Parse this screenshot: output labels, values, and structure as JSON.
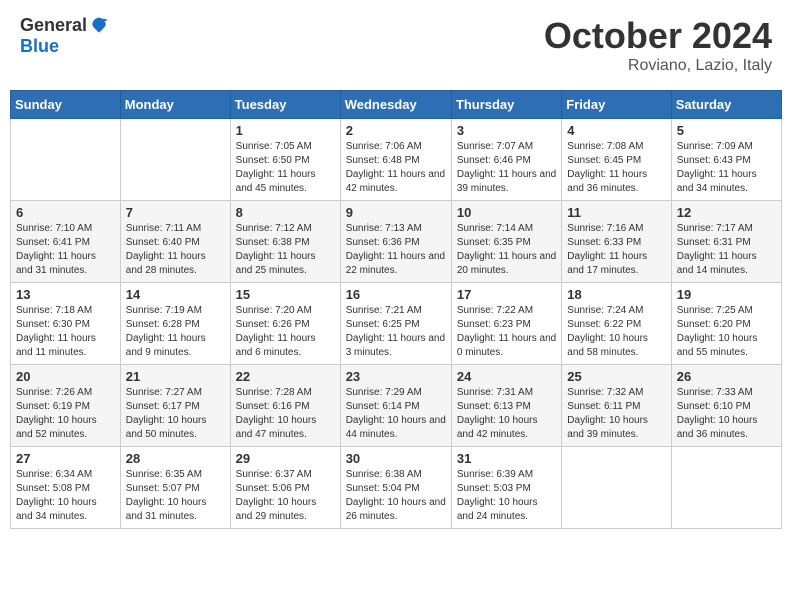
{
  "header": {
    "logo_general": "General",
    "logo_blue": "Blue",
    "month": "October 2024",
    "location": "Roviano, Lazio, Italy"
  },
  "weekdays": [
    "Sunday",
    "Monday",
    "Tuesday",
    "Wednesday",
    "Thursday",
    "Friday",
    "Saturday"
  ],
  "weeks": [
    [
      {
        "day": "",
        "info": ""
      },
      {
        "day": "",
        "info": ""
      },
      {
        "day": "1",
        "info": "Sunrise: 7:05 AM\nSunset: 6:50 PM\nDaylight: 11 hours and 45 minutes."
      },
      {
        "day": "2",
        "info": "Sunrise: 7:06 AM\nSunset: 6:48 PM\nDaylight: 11 hours and 42 minutes."
      },
      {
        "day": "3",
        "info": "Sunrise: 7:07 AM\nSunset: 6:46 PM\nDaylight: 11 hours and 39 minutes."
      },
      {
        "day": "4",
        "info": "Sunrise: 7:08 AM\nSunset: 6:45 PM\nDaylight: 11 hours and 36 minutes."
      },
      {
        "day": "5",
        "info": "Sunrise: 7:09 AM\nSunset: 6:43 PM\nDaylight: 11 hours and 34 minutes."
      }
    ],
    [
      {
        "day": "6",
        "info": "Sunrise: 7:10 AM\nSunset: 6:41 PM\nDaylight: 11 hours and 31 minutes."
      },
      {
        "day": "7",
        "info": "Sunrise: 7:11 AM\nSunset: 6:40 PM\nDaylight: 11 hours and 28 minutes."
      },
      {
        "day": "8",
        "info": "Sunrise: 7:12 AM\nSunset: 6:38 PM\nDaylight: 11 hours and 25 minutes."
      },
      {
        "day": "9",
        "info": "Sunrise: 7:13 AM\nSunset: 6:36 PM\nDaylight: 11 hours and 22 minutes."
      },
      {
        "day": "10",
        "info": "Sunrise: 7:14 AM\nSunset: 6:35 PM\nDaylight: 11 hours and 20 minutes."
      },
      {
        "day": "11",
        "info": "Sunrise: 7:16 AM\nSunset: 6:33 PM\nDaylight: 11 hours and 17 minutes."
      },
      {
        "day": "12",
        "info": "Sunrise: 7:17 AM\nSunset: 6:31 PM\nDaylight: 11 hours and 14 minutes."
      }
    ],
    [
      {
        "day": "13",
        "info": "Sunrise: 7:18 AM\nSunset: 6:30 PM\nDaylight: 11 hours and 11 minutes."
      },
      {
        "day": "14",
        "info": "Sunrise: 7:19 AM\nSunset: 6:28 PM\nDaylight: 11 hours and 9 minutes."
      },
      {
        "day": "15",
        "info": "Sunrise: 7:20 AM\nSunset: 6:26 PM\nDaylight: 11 hours and 6 minutes."
      },
      {
        "day": "16",
        "info": "Sunrise: 7:21 AM\nSunset: 6:25 PM\nDaylight: 11 hours and 3 minutes."
      },
      {
        "day": "17",
        "info": "Sunrise: 7:22 AM\nSunset: 6:23 PM\nDaylight: 11 hours and 0 minutes."
      },
      {
        "day": "18",
        "info": "Sunrise: 7:24 AM\nSunset: 6:22 PM\nDaylight: 10 hours and 58 minutes."
      },
      {
        "day": "19",
        "info": "Sunrise: 7:25 AM\nSunset: 6:20 PM\nDaylight: 10 hours and 55 minutes."
      }
    ],
    [
      {
        "day": "20",
        "info": "Sunrise: 7:26 AM\nSunset: 6:19 PM\nDaylight: 10 hours and 52 minutes."
      },
      {
        "day": "21",
        "info": "Sunrise: 7:27 AM\nSunset: 6:17 PM\nDaylight: 10 hours and 50 minutes."
      },
      {
        "day": "22",
        "info": "Sunrise: 7:28 AM\nSunset: 6:16 PM\nDaylight: 10 hours and 47 minutes."
      },
      {
        "day": "23",
        "info": "Sunrise: 7:29 AM\nSunset: 6:14 PM\nDaylight: 10 hours and 44 minutes."
      },
      {
        "day": "24",
        "info": "Sunrise: 7:31 AM\nSunset: 6:13 PM\nDaylight: 10 hours and 42 minutes."
      },
      {
        "day": "25",
        "info": "Sunrise: 7:32 AM\nSunset: 6:11 PM\nDaylight: 10 hours and 39 minutes."
      },
      {
        "day": "26",
        "info": "Sunrise: 7:33 AM\nSunset: 6:10 PM\nDaylight: 10 hours and 36 minutes."
      }
    ],
    [
      {
        "day": "27",
        "info": "Sunrise: 6:34 AM\nSunset: 5:08 PM\nDaylight: 10 hours and 34 minutes."
      },
      {
        "day": "28",
        "info": "Sunrise: 6:35 AM\nSunset: 5:07 PM\nDaylight: 10 hours and 31 minutes."
      },
      {
        "day": "29",
        "info": "Sunrise: 6:37 AM\nSunset: 5:06 PM\nDaylight: 10 hours and 29 minutes."
      },
      {
        "day": "30",
        "info": "Sunrise: 6:38 AM\nSunset: 5:04 PM\nDaylight: 10 hours and 26 minutes."
      },
      {
        "day": "31",
        "info": "Sunrise: 6:39 AM\nSunset: 5:03 PM\nDaylight: 10 hours and 24 minutes."
      },
      {
        "day": "",
        "info": ""
      },
      {
        "day": "",
        "info": ""
      }
    ]
  ]
}
